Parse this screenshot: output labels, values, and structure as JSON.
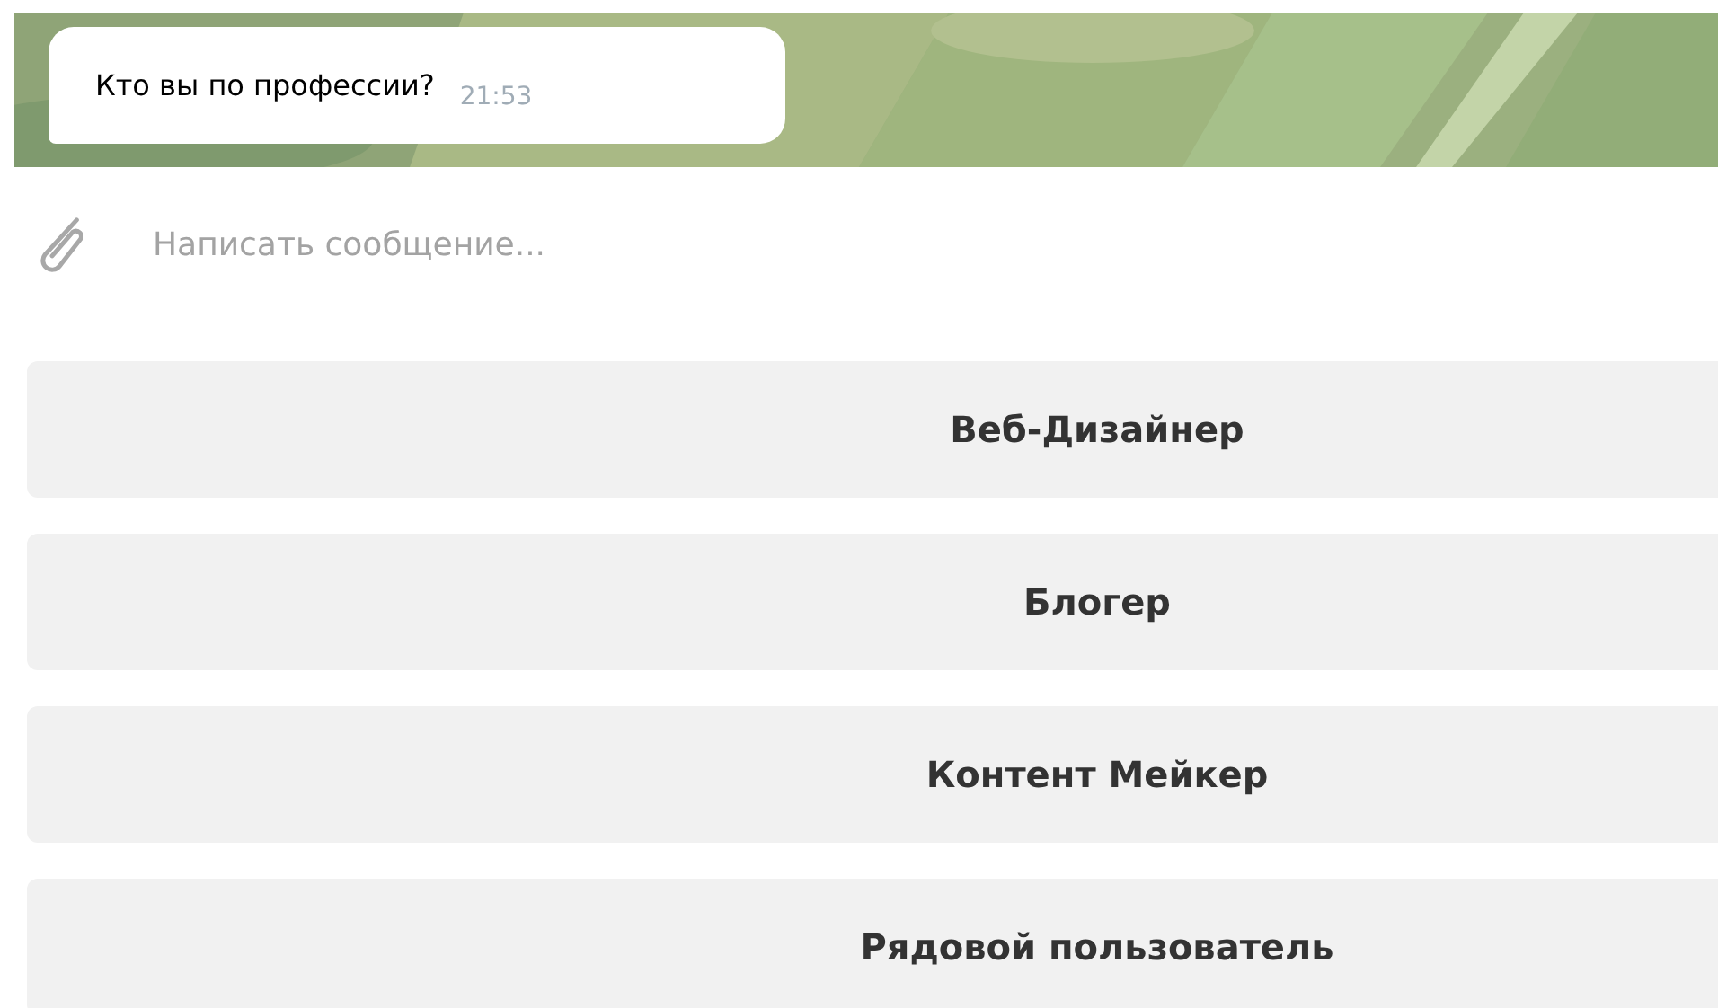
{
  "message": {
    "text": "Кто вы по профессии?",
    "time": "21:53"
  },
  "composer": {
    "placeholder": "Написать сообщение..."
  },
  "keyboard": [
    {
      "label": "Веб-Дизайнер"
    },
    {
      "label": "Блогер"
    },
    {
      "label": "Контент Мейкер"
    },
    {
      "label": "Рядовой пользователь"
    }
  ]
}
